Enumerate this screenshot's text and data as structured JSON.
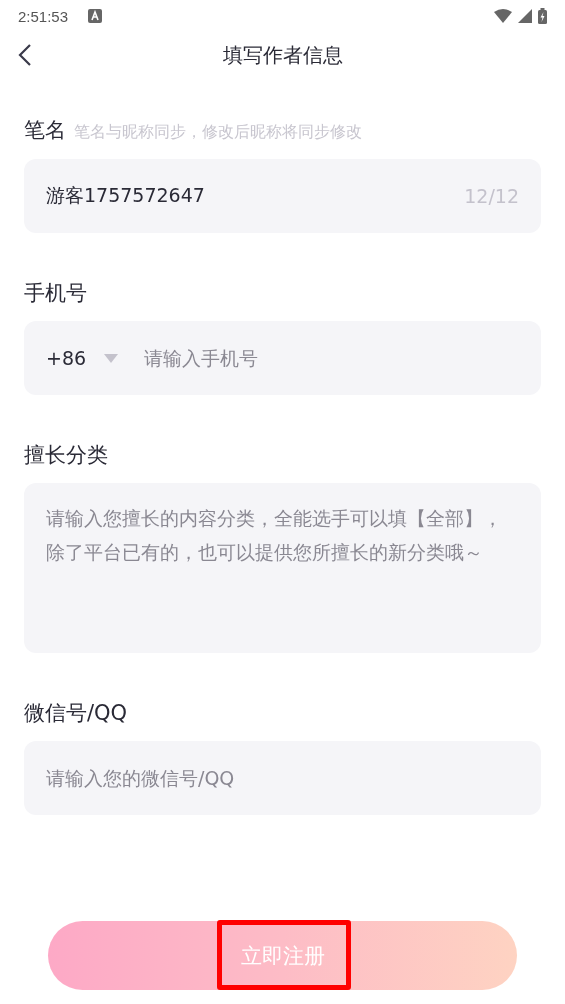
{
  "status_bar": {
    "time": "2:51:53"
  },
  "header": {
    "title": "填写作者信息"
  },
  "fields": [
    {
      "kind": "text",
      "label": "笔名",
      "hint": "笔名与昵称同步，修改后昵称将同步修改",
      "value": "游客1757572647",
      "counter": "12/12"
    },
    {
      "kind": "phone",
      "label": "手机号",
      "prefix": "+86",
      "placeholder": "请输入手机号"
    },
    {
      "kind": "textarea",
      "label": "擅长分类",
      "placeholder": "请输入您擅长的内容分类，全能选手可以填【全部】，除了平台已有的，也可以提供您所擅长的新分类哦～"
    },
    {
      "kind": "text",
      "label": "微信号/QQ",
      "placeholder": "请输入您的微信号/QQ"
    }
  ],
  "submit_button": {
    "label": "立即注册",
    "disabled": true,
    "highlighted": true
  }
}
